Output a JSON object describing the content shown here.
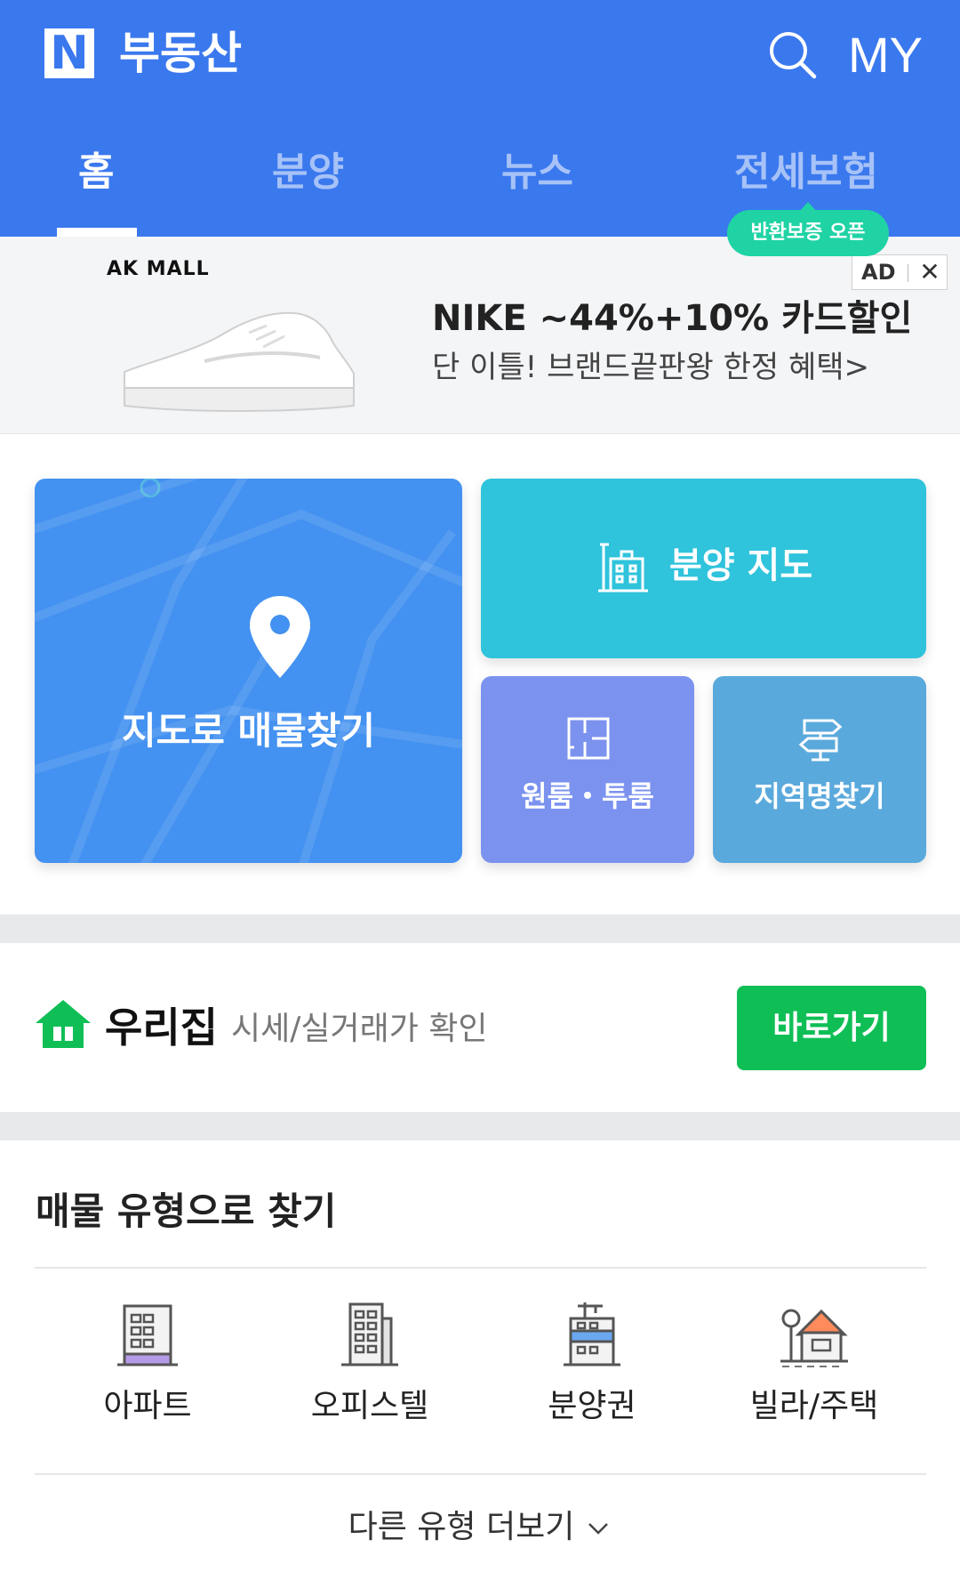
{
  "header": {
    "logo_letter": "N",
    "brand": "부동산",
    "search_icon": "search-icon",
    "my_label": "MY",
    "background": "#3a78ee"
  },
  "tabs": [
    {
      "label": "홈",
      "active": true
    },
    {
      "label": "분양",
      "active": false
    },
    {
      "label": "뉴스",
      "active": false
    },
    {
      "label": "전세보험",
      "active": false
    }
  ],
  "tab_badge": "반환보증 오픈",
  "ad": {
    "brand_logo": "AK MALL",
    "title": "NIKE ~44%+10% 카드할인",
    "subtitle": "단 이틀! 브랜드끝판왕 한정 혜택>",
    "mark_label": "AD",
    "close_icon": "close-icon"
  },
  "quick_menu": {
    "map_search": {
      "label": "지도로 매물찾기",
      "icon": "location-pin-icon",
      "color": "#4391f0"
    },
    "bunyang_map": {
      "label": "분양 지도",
      "icon": "building-icon",
      "color": "#2fc3dc"
    },
    "oneroom": {
      "label": "원룸・투룸",
      "icon": "floorplan-icon",
      "color": "#7b92ef"
    },
    "region_search": {
      "label": "지역명찾기",
      "icon": "signpost-icon",
      "color": "#5aa9dc"
    }
  },
  "our_home": {
    "icon": "house-icon",
    "title": "우리집",
    "description": "시세/실거래가 확인",
    "button_label": "바로가기",
    "button_color": "#0fbf56"
  },
  "property_types": {
    "title": "매물 유형으로 찾기",
    "items": [
      {
        "label": "아파트",
        "icon": "apartment-icon"
      },
      {
        "label": "오피스텔",
        "icon": "officetel-icon"
      },
      {
        "label": "분양권",
        "icon": "presale-building-icon"
      },
      {
        "label": "빌라/주택",
        "icon": "villa-house-icon"
      }
    ],
    "more_label": "다른 유형 더보기",
    "more_icon": "chevron-down-icon"
  }
}
